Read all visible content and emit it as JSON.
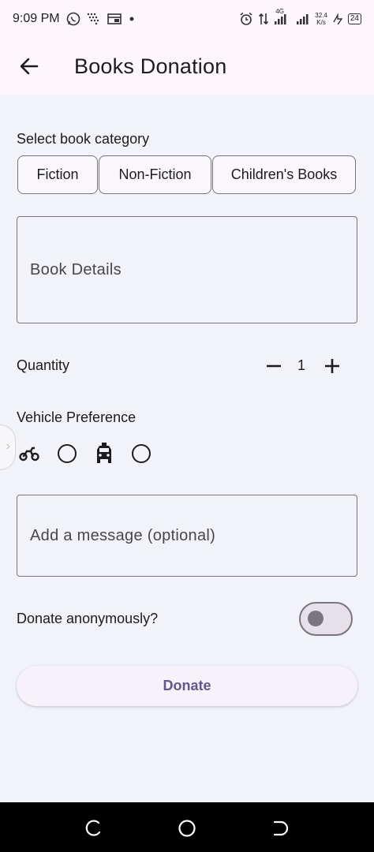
{
  "status_bar": {
    "time": "9:09 PM",
    "network_type": "4G",
    "speed_value": "32.4",
    "speed_unit": "K/s",
    "battery": "24"
  },
  "app_bar": {
    "title": "Books Donation"
  },
  "category": {
    "label": "Select book category",
    "chips": [
      "Fiction",
      "Non-Fiction",
      "Children's Books"
    ]
  },
  "book_details": {
    "placeholder": "Book Details"
  },
  "quantity": {
    "label": "Quantity",
    "value": "1"
  },
  "vehicle": {
    "label": "Vehicle Preference",
    "options": [
      "motorcycle-icon",
      "car-icon"
    ]
  },
  "message": {
    "placeholder": "Add a message (optional)"
  },
  "anonymous": {
    "label": "Donate anonymously?",
    "enabled": false
  },
  "donate_button": {
    "label": "Donate"
  },
  "colors": {
    "background": "#f1f3f8",
    "app_bar": "#fdf7fd",
    "primary_text": "#65558f",
    "outline": "#79747e"
  }
}
